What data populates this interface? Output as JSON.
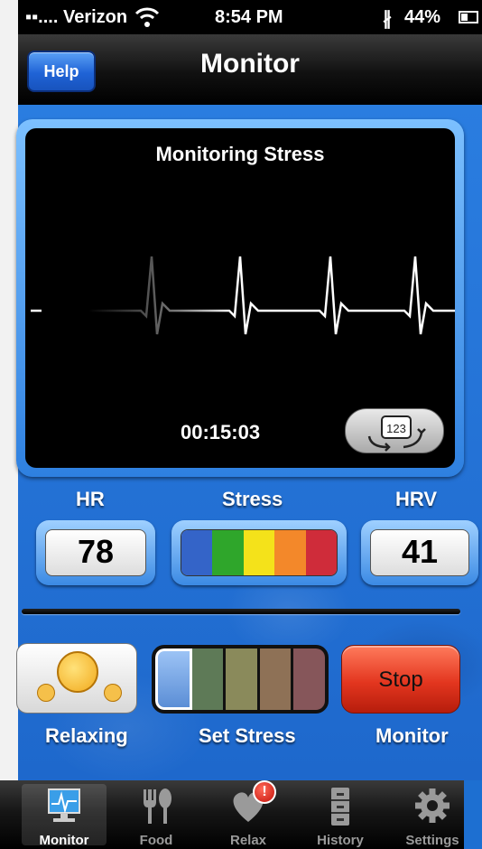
{
  "status_bar": {
    "carrier": "Verizon",
    "time": "8:54 PM",
    "battery": "44%",
    "battery_level": 0.44
  },
  "navbar": {
    "help_label": "Help",
    "title": "Monitor"
  },
  "monitor": {
    "title": "Monitoring Stress",
    "timer": "00:15:03",
    "toggle_icon_text": "123"
  },
  "metrics": {
    "hr_label": "HR",
    "hr_value": "78",
    "stress_label": "Stress",
    "stress_colors": [
      "#3464c8",
      "#2fa62b",
      "#f4e21a",
      "#f3882a",
      "#cf2c3a"
    ],
    "hrv_label": "HRV",
    "hrv_value": "41"
  },
  "actions": {
    "relaxing_label": "Relaxing",
    "set_stress_label": "Set Stress",
    "stop_label": "Stop",
    "monitor_label": "Monitor",
    "set_stress_colors": [
      "#5b8ed6",
      "#5e7a57",
      "#8a8a5b",
      "#8e7156",
      "#86565a"
    ]
  },
  "tabs": [
    {
      "label": "Monitor",
      "icon": "heart-monitor-icon",
      "active": true
    },
    {
      "label": "Food",
      "icon": "fork-spoon-icon",
      "active": false
    },
    {
      "label": "Relax",
      "icon": "heart-icon",
      "active": false,
      "badge": "!"
    },
    {
      "label": "History",
      "icon": "file-cabinet-icon",
      "active": false
    },
    {
      "label": "Settings",
      "icon": "gear-icon",
      "active": false
    }
  ]
}
